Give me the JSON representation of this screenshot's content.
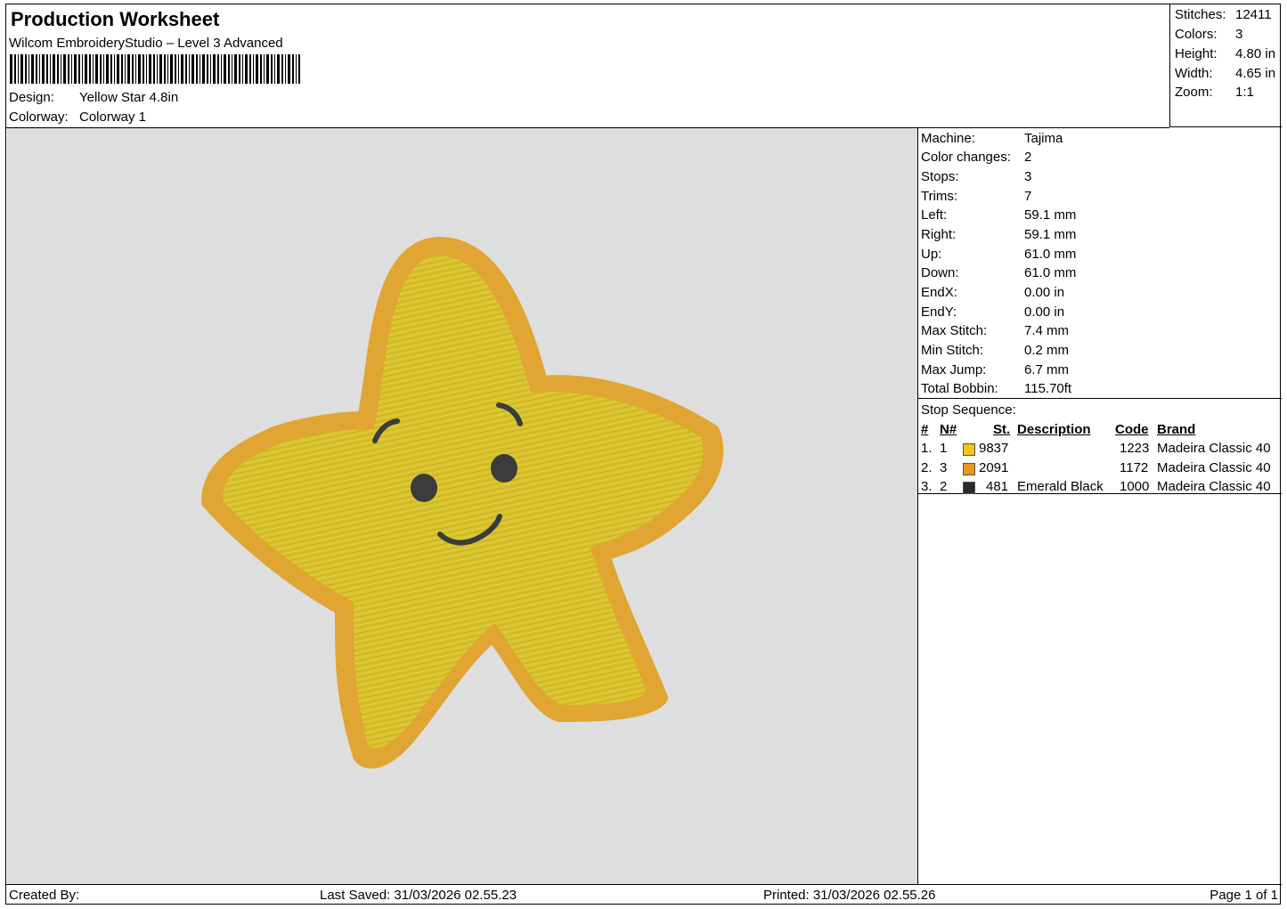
{
  "header": {
    "title": "Production Worksheet",
    "software": "Wilcom EmbroideryStudio – Level 3 Advanced",
    "design_label": "Design:",
    "design_value": "Yellow Star 4.8in",
    "colorway_label": "Colorway:",
    "colorway_value": "Colorway 1"
  },
  "stats": [
    {
      "label": "Stitches:",
      "value": "12411"
    },
    {
      "label": "Colors:",
      "value": "3"
    },
    {
      "label": "Height:",
      "value": "4.80 in"
    },
    {
      "label": "Width:",
      "value": "4.65 in"
    },
    {
      "label": "Zoom:",
      "value": "1:1"
    }
  ],
  "machine": [
    {
      "label": "Machine:",
      "value": "Tajima"
    },
    {
      "label": "Color changes:",
      "value": "2"
    },
    {
      "label": "Stops:",
      "value": "3"
    },
    {
      "label": "Trims:",
      "value": "7"
    },
    {
      "label": "Left:",
      "value": "59.1 mm"
    },
    {
      "label": "Right:",
      "value": "59.1 mm"
    },
    {
      "label": "Up:",
      "value": "61.0 mm"
    },
    {
      "label": "Down:",
      "value": "61.0 mm"
    },
    {
      "label": "EndX:",
      "value": "0.00 in"
    },
    {
      "label": "EndY:",
      "value": "0.00 in"
    },
    {
      "label": "Max Stitch:",
      "value": "7.4 mm"
    },
    {
      "label": "Min Stitch:",
      "value": "0.2 mm"
    },
    {
      "label": "Max Jump:",
      "value": "6.7 mm"
    },
    {
      "label": "Total Bobbin:",
      "value": "115.70ft"
    }
  ],
  "stop_sequence": {
    "title": "Stop Sequence:",
    "headers": {
      "num": "#",
      "needle": "N#",
      "st": "St.",
      "description": "Description",
      "code": "Code",
      "brand": "Brand"
    },
    "rows": [
      {
        "num": "1.",
        "needle": "1",
        "color": "#f2c318",
        "st": "9837",
        "description": "",
        "code": "1223",
        "brand": "Madeira Classic 40"
      },
      {
        "num": "2.",
        "needle": "3",
        "color": "#e8971e",
        "st": "2091",
        "description": "",
        "code": "1172",
        "brand": "Madeira Classic 40"
      },
      {
        "num": "3.",
        "needle": "2",
        "color": "#2a2a2a",
        "st": "481",
        "description": "Emerald Black",
        "code": "1000",
        "brand": "Madeira Classic 40"
      }
    ]
  },
  "design_colors": {
    "fill": "#d9c22a",
    "border": "#e0a532",
    "face": "#3a3d3c",
    "background": "#dedede"
  },
  "footer": {
    "created_by": "Created By:",
    "last_saved": "Last Saved: 31/03/2026 02.55.23",
    "printed": "Printed: 31/03/2026 02.55.26",
    "page": "Page 1 of 1"
  }
}
